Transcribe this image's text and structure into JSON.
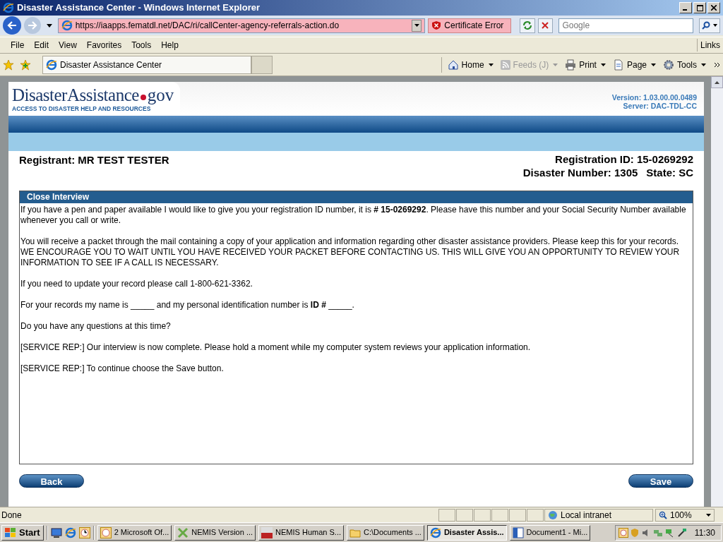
{
  "window": {
    "title": "Disaster Assistance Center - Windows Internet Explorer"
  },
  "address_bar": {
    "url": "https://iaapps.fematdl.net/DAC/ri/callCenter-agency-referrals-action.do",
    "certificate_error": "Certificate Error",
    "search_placeholder": "Google"
  },
  "menu": [
    "File",
    "Edit",
    "View",
    "Favorites",
    "Tools",
    "Help"
  ],
  "links_label": "Links",
  "tab": {
    "title": "Disaster Assistance Center"
  },
  "command_bar": [
    {
      "kind": "home",
      "label": "Home",
      "disabled": false
    },
    {
      "kind": "feeds",
      "label": "Feeds (J)",
      "disabled": true
    },
    {
      "kind": "print",
      "label": "Print",
      "disabled": false
    },
    {
      "kind": "page",
      "label": "Page",
      "disabled": false
    },
    {
      "kind": "tools",
      "label": "Tools",
      "disabled": false
    }
  ],
  "page": {
    "logo_name": "DisasterAssistance",
    "logo_suffix": "gov",
    "tagline": "ACCESS TO DISASTER HELP AND RESOURCES",
    "version": "Version: 1.03.00.00.0489",
    "server": "Server: DAC-TDL-CC",
    "registrant": "Registrant: MR TEST TESTER",
    "registration_id": "Registration ID: 15-0269292",
    "disaster_number": "Disaster Number: 1305",
    "state": "State: SC",
    "panel_title": "Close Interview",
    "paragraphs": [
      "If you have a pen and paper available I would like to give you your registration ID number, it is **# 15-0269292**. Please have this number and your Social Security Number available whenever you call or write.",
      "You will receive a packet through the mail containing a copy of your application and information regarding other disaster assistance providers. Please keep this for your records. WE ENCOURAGE YOU TO WAIT UNTIL YOU HAVE RECEIVED YOUR PACKET BEFORE CONTACTING US. THIS WILL GIVE YOU AN OPPORTUNITY TO REVIEW YOUR INFORMATION TO SEE IF A CALL IS NECESSARY.",
      "If you need to update your record please call 1-800-621-3362.",
      "For your records my name is _____ and my personal identification number is **ID #** _____.",
      "Do you have any questions at this time?",
      "[SERVICE REP:] Our interview is now complete. Please hold a moment while my computer system reviews your application information.",
      "[SERVICE REP:] To continue choose the Save button."
    ],
    "buttons": [
      "Back",
      "Save"
    ]
  },
  "status_bar": {
    "text": "Done",
    "zone": "Local intranet",
    "zoom": "100%"
  },
  "taskbar": {
    "start": "Start",
    "items": [
      {
        "label": "2 Microsoft Of...",
        "selected": false
      },
      {
        "label": "NEMIS Version ...",
        "selected": false
      },
      {
        "label": "NEMIS Human S...",
        "selected": false
      },
      {
        "label": "C:\\Documents ...",
        "selected": false
      },
      {
        "label": "Disaster Assis...",
        "selected": true
      },
      {
        "label": "Document1 - Mi...",
        "selected": false
      }
    ],
    "clock": "11:30"
  }
}
